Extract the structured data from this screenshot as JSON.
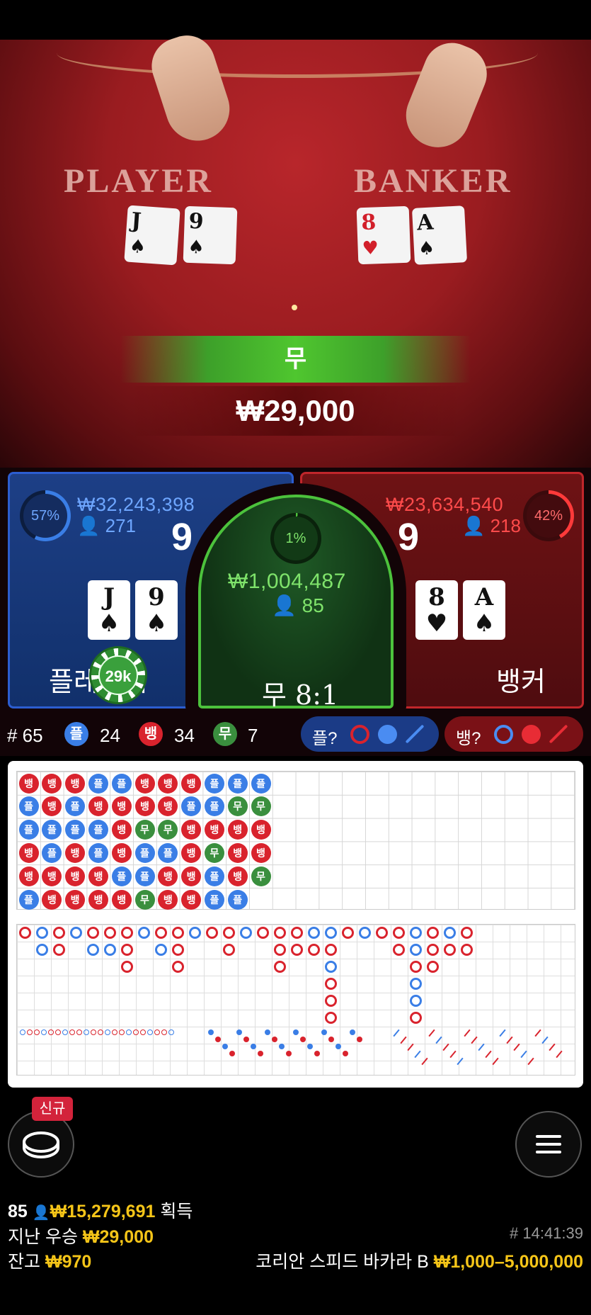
{
  "table": {
    "player_label": "PLAYER",
    "banker_label": "BANKER",
    "player_cards": [
      {
        "rank": "J",
        "suit": "♠"
      },
      {
        "rank": "9",
        "suit": "♠"
      }
    ],
    "banker_cards": [
      {
        "rank": "8",
        "suit": "♥"
      },
      {
        "rank": "A",
        "suit": "♠"
      }
    ],
    "result_label": "무",
    "result_amount": "₩29,000"
  },
  "player": {
    "percent": "57%",
    "amount": "₩32,243,398",
    "count": "271",
    "score": "9",
    "cards": [
      {
        "rank": "J",
        "suit": "♠"
      },
      {
        "rank": "9",
        "suit": "♠"
      }
    ],
    "label": "플레이어",
    "chip": "29k"
  },
  "tie": {
    "percent": "1%",
    "amount": "₩1,004,487",
    "count": "85",
    "label": "무 8:1"
  },
  "banker": {
    "percent": "42%",
    "amount": "₩23,634,540",
    "count": "218",
    "score": "9",
    "cards": [
      {
        "rank": "8",
        "suit": "♥"
      },
      {
        "rank": "A",
        "suit": "♠"
      }
    ],
    "label": "뱅커"
  },
  "stats": {
    "round": "# 65",
    "player_badge": "플",
    "player_count": "24",
    "banker_badge": "뱅",
    "banker_count": "34",
    "tie_badge": "무",
    "tie_count": "7",
    "player_ask": "플?",
    "banker_ask": "뱅?"
  },
  "colors": {
    "player": "#3a7ee6",
    "banker": "#d9232d",
    "tie": "#3a8f3e",
    "gold": "#f5c518"
  },
  "bead_road": [
    [
      "뱅",
      "플",
      "플",
      "뱅",
      "뱅",
      "플"
    ],
    [
      "뱅",
      "뱅",
      "플",
      "플",
      "뱅",
      "뱅"
    ],
    [
      "뱅",
      "플",
      "플",
      "뱅",
      "뱅",
      "뱅"
    ],
    [
      "플",
      "뱅",
      "플",
      "플",
      "뱅",
      "뱅"
    ],
    [
      "플",
      "뱅",
      "뱅",
      "뱅",
      "플",
      "뱅"
    ],
    [
      "뱅",
      "뱅",
      "무",
      "플",
      "플",
      "무"
    ],
    [
      "뱅",
      "뱅",
      "무",
      "플",
      "뱅",
      "뱅"
    ],
    [
      "뱅",
      "플",
      "뱅",
      "뱅",
      "뱅",
      "뱅"
    ],
    [
      "플",
      "플",
      "뱅",
      "무",
      "플",
      "플"
    ],
    [
      "플",
      "무",
      "뱅",
      "뱅",
      "뱅",
      "플"
    ],
    [
      "플",
      "무",
      "뱅",
      "뱅",
      "무",
      ""
    ]
  ],
  "icons": {
    "lobby": "chip-stack-icon",
    "menu": "hamburger-icon",
    "user": "user-icon"
  },
  "bottom": {
    "new_badge": "신규",
    "winners_count": "85",
    "winners_amount": "₩15,279,691",
    "winners_label": "획득",
    "last_win_label": "지난 우승",
    "last_win_amount": "₩29,000",
    "time": "# 14:41:39",
    "balance_label": "잔고",
    "balance_amount": "₩970",
    "table_name": "코리안 스피드 바카라 B",
    "limits": "₩1,000–5,000,000"
  }
}
